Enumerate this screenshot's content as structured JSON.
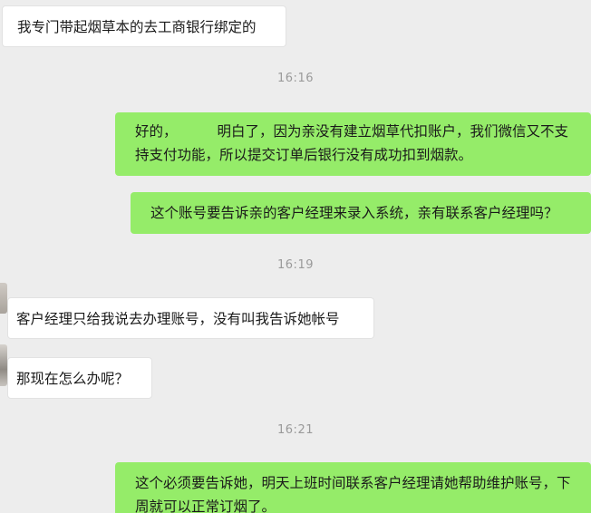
{
  "messages": {
    "m1": {
      "text": "我专门带起烟草本的去工商银行绑定的"
    },
    "t1": "16:16",
    "m2": {
      "part1": "好的，",
      "part2": "明白了，因为亲没有建立烟草代扣账户，我们微信又不支持支付功能，所以提交订单后银行没有成功扣到烟款。"
    },
    "m3": {
      "text": "这个账号要告诉亲的客户经理来录入系统，亲有联系客户经理吗？"
    },
    "t2": "16:19",
    "m4": {
      "text": "客户经理只给我说去办理账号，没有叫我告诉她帐号"
    },
    "m5": {
      "text": "那现在怎么办呢？"
    },
    "t3": "16:21",
    "m6": {
      "text": "这个必须要告诉她，明天上班时间联系客户经理请她帮助维护账号，下周就可以正常订烟了。"
    }
  },
  "colors": {
    "background": "#ededed",
    "outgoing_bubble": "#95ec69",
    "incoming_bubble": "#ffffff",
    "timestamp": "#9a9a9a"
  }
}
